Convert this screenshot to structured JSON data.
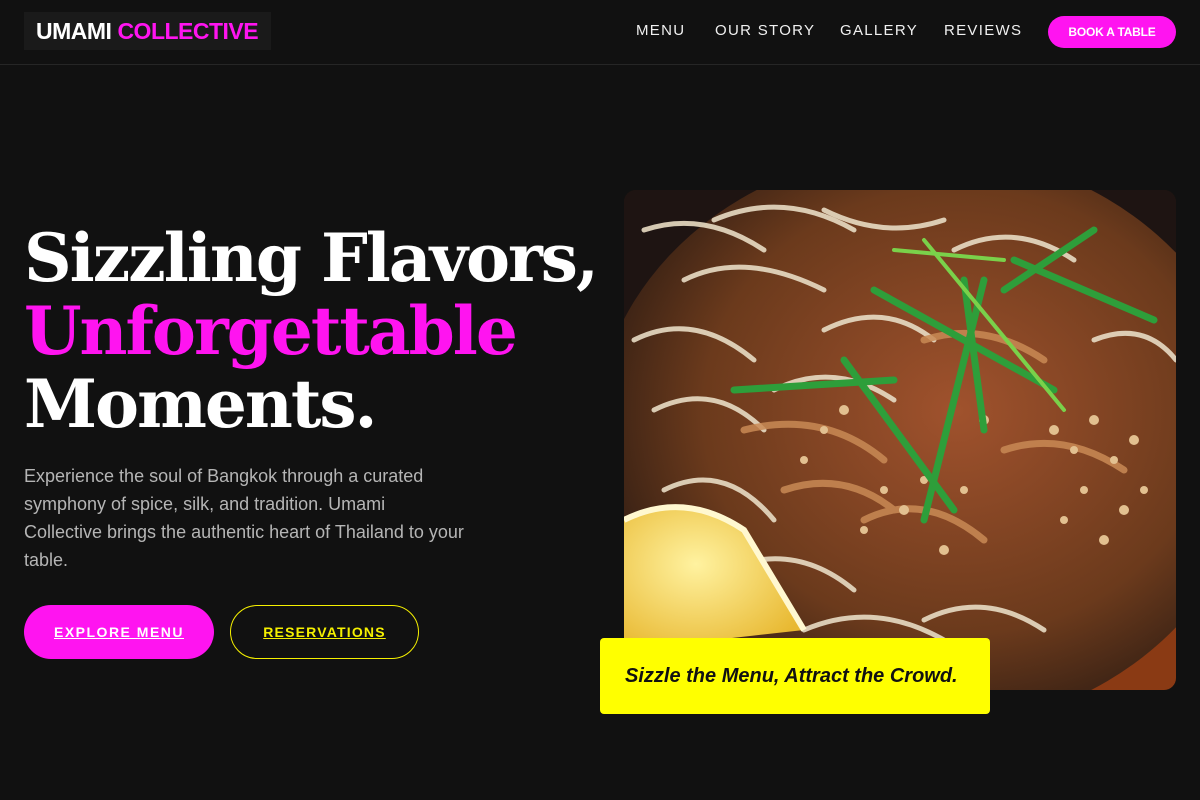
{
  "brand": {
    "name_primary": "UMAMI",
    "name_accent": "COLLECTIVE",
    "accent_color": "#ff14f0",
    "highlight_color": "#ffff00"
  },
  "nav": {
    "items": [
      {
        "label": "MENU"
      },
      {
        "label": "OUR STORY"
      },
      {
        "label": "GALLERY"
      },
      {
        "label": "REVIEWS"
      }
    ],
    "cta_label": "BOOK A TABLE"
  },
  "hero": {
    "headline_line1": "Sizzling Flavors,",
    "headline_line2": "Unforgettable",
    "headline_line3": "Moments.",
    "description": "Experience the soul of Bangkok through a curated symphony of spice, silk, and tradition. Umami Collective brings the authentic heart of Thailand to your table.",
    "primary_button": "EXPLORE MENU",
    "secondary_button": "RESERVATIONS",
    "image_subject": "pad-thai-noodles",
    "tagline": "Sizzle the Menu, Attract the Crowd."
  }
}
